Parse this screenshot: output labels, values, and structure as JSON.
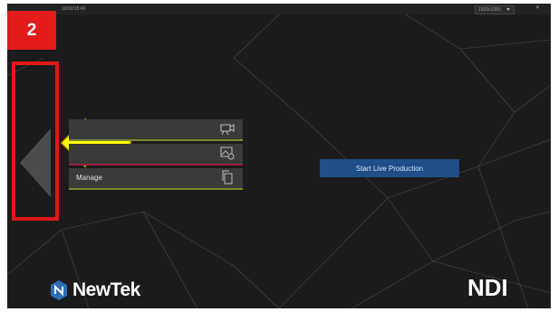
{
  "annotation": {
    "step_number": "2",
    "highlight_color": "#e01818",
    "arrow_color": "#ffff00"
  },
  "topbar": {
    "datetime": "10/02/15:46",
    "resolution": "1920x1080",
    "close_icon": "close-icon"
  },
  "menu": {
    "items": [
      {
        "label": "",
        "icon": "camera-icon",
        "accent": "#7a8a2e"
      },
      {
        "label": "",
        "icon": "image-settings-icon",
        "accent": "#9a1c3c"
      },
      {
        "label": "Manage",
        "icon": "copy-icon",
        "accent": "#7a8a2e"
      }
    ]
  },
  "main": {
    "start_button_label": "Start Live Production",
    "accent": "#1f4e88"
  },
  "branding": {
    "newtek": "NewTek",
    "ndi": "NDI"
  }
}
